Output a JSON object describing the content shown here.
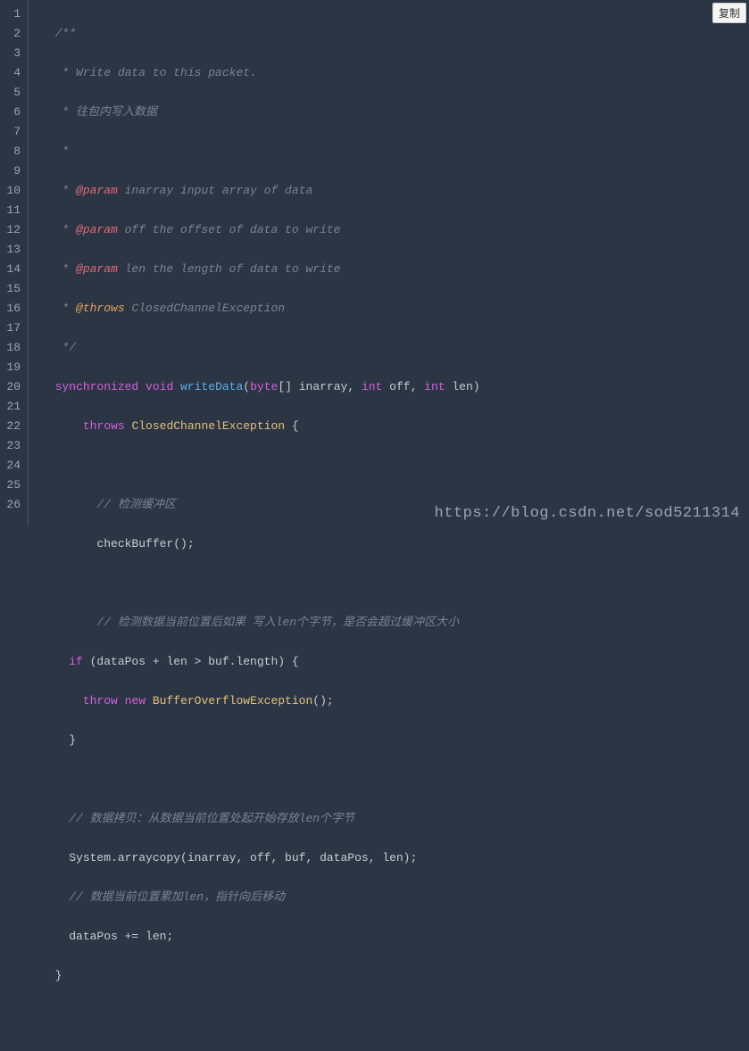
{
  "copy_label": "复制",
  "watermark": "https://blog.csdn.net/sod5211314",
  "line_count": 26,
  "code": {
    "l1": {
      "indent": "  ",
      "txt": "/**"
    },
    "l2": {
      "indent": "   ",
      "txt": "* Write data to this packet."
    },
    "l3": {
      "indent": "   ",
      "txt": "* 往包内写入数据"
    },
    "l4": {
      "indent": "   ",
      "txt": "*"
    },
    "l5": {
      "indent": "   ",
      "pre": "* ",
      "tag": "@param",
      "rest": " inarray input array of data"
    },
    "l6": {
      "indent": "   ",
      "pre": "* ",
      "tag": "@param",
      "rest": " off the offset of data to write"
    },
    "l7": {
      "indent": "   ",
      "pre": "* ",
      "tag": "@param",
      "rest": " len the length of data to write"
    },
    "l8": {
      "indent": "   ",
      "pre": "* ",
      "tag": "@throws",
      "rest": " ClosedChannelException"
    },
    "l9": {
      "indent": "   ",
      "txt": "*/"
    },
    "l10": {
      "kw1": "synchronized",
      "kw2": "void",
      "fn": "writeData",
      "p1": "byte",
      "p1b": "[] inarray, ",
      "p2": "int",
      "p2b": " off, ",
      "p3": "int",
      "p3b": " len)"
    },
    "l11": {
      "kw": "throws",
      "cls": "ClosedChannelException",
      "rest": " {"
    },
    "l13": {
      "txt": "// 检测缓冲区"
    },
    "l14": {
      "txt": "checkBuffer();"
    },
    "l16": {
      "txt": "// 检测数据当前位置后如果 写入len个字节，是否会超过缓冲区大小"
    },
    "l17": {
      "kw": "if",
      "rest": " (dataPos + len > buf.length) {"
    },
    "l18": {
      "kw1": "throw",
      "kw2": "new",
      "cls": "BufferOverflowException",
      "rest": "();"
    },
    "l19": {
      "txt": "}"
    },
    "l21": {
      "txt": "// 数据拷贝：从数据当前位置处起开始存放len个字节"
    },
    "l22": {
      "txt": "System.arraycopy(inarray, off, buf, dataPos, len);"
    },
    "l23": {
      "txt": "// 数据当前位置累加len，指针向后移动"
    },
    "l24": {
      "txt": "dataPos += len;"
    },
    "l25": {
      "txt": "}"
    }
  }
}
